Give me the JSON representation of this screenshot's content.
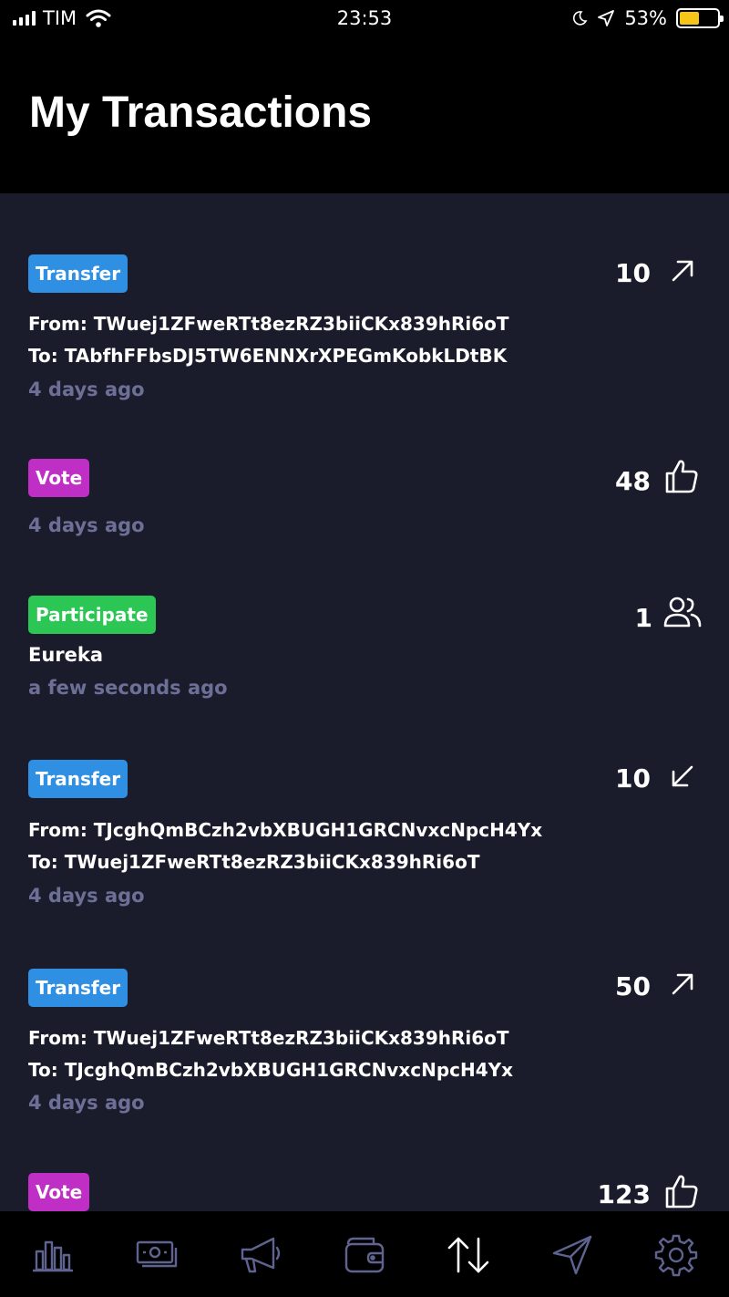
{
  "status_bar": {
    "carrier": "TIM",
    "time": "23:53",
    "battery_percent": "53%",
    "battery_level": 0.53,
    "battery_color": "#f5c518"
  },
  "header": {
    "title": "My Transactions"
  },
  "colors": {
    "transfer": "#2f8fe2",
    "vote": "#bf2fc6",
    "participate": "#2bc653",
    "content_bg": "#1b1c2b",
    "muted_text": "#6d6f96"
  },
  "transactions": [
    {
      "type": "Transfer",
      "amount": "10",
      "direction_icon": "arrow-up-right-icon",
      "from": "From: TWuej1ZFweRTt8ezRZ3biiCKx839hRi6oT",
      "to": "To: TAbfhFFbsDJ5TW6ENNXrXPEGmKobkLDtBK",
      "time": "4 days ago"
    },
    {
      "type": "Vote",
      "amount": "48",
      "direction_icon": "thumbs-up-icon",
      "time": "4 days ago"
    },
    {
      "type": "Participate",
      "amount": "1",
      "direction_icon": "users-icon",
      "name": "Eureka",
      "time": "a few seconds ago"
    },
    {
      "type": "Transfer",
      "amount": "10",
      "direction_icon": "arrow-down-left-icon",
      "from": "From: TJcghQmBCzh2vbXBUGH1GRCNvxcNpcH4Yx",
      "to": "To: TWuej1ZFweRTt8ezRZ3biiCKx839hRi6oT",
      "time": "4 days ago"
    },
    {
      "type": "Transfer",
      "amount": "50",
      "direction_icon": "arrow-up-right-icon",
      "from": "From: TWuej1ZFweRTt8ezRZ3biiCKx839hRi6oT",
      "to": "To: TJcghQmBCzh2vbXBUGH1GRCNvxcNpcH4Yx",
      "time": "4 days ago"
    },
    {
      "type": "Vote",
      "amount": "123",
      "direction_icon": "thumbs-up-icon"
    }
  ],
  "tab_bar": {
    "tabs": [
      {
        "icon": "bar-chart-icon",
        "active": false
      },
      {
        "icon": "money-icon",
        "active": false
      },
      {
        "icon": "megaphone-icon",
        "active": false
      },
      {
        "icon": "wallet-icon",
        "active": false
      },
      {
        "icon": "transactions-icon",
        "active": true
      },
      {
        "icon": "send-icon",
        "active": false
      },
      {
        "icon": "settings-gear-icon",
        "active": false
      }
    ]
  }
}
